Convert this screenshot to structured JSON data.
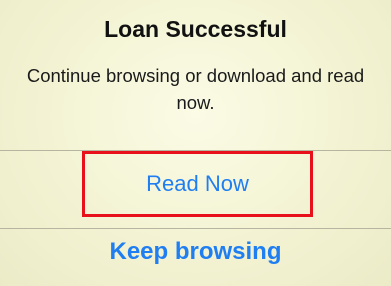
{
  "dialog": {
    "title": "Loan Successful",
    "message": "Continue browsing or download and read now.",
    "primary_action_label": "Read Now",
    "secondary_action_label": "Keep browsing"
  },
  "colors": {
    "action_text": "#1f7ef2",
    "highlight_border": "#e8101a",
    "background": "#f3f3d3"
  }
}
